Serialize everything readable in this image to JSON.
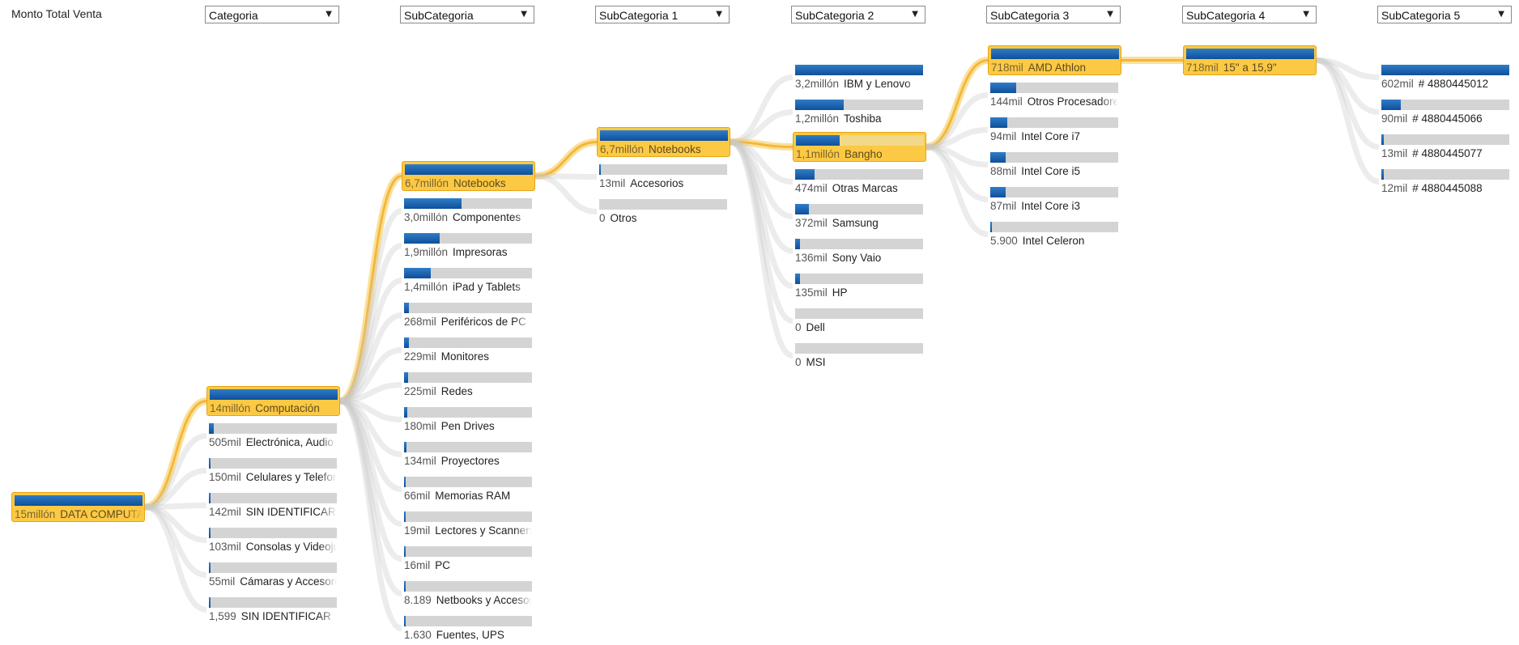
{
  "root_label": "Monto Total Venta",
  "dropdowns": [
    "Categoria",
    "SubCategoria",
    "SubCategoria 1",
    "SubCategoria 2",
    "SubCategoria 3",
    "SubCategoria 4",
    "SubCategoria 5"
  ],
  "colors": {
    "selected_bg": "#fcc944",
    "selected_border": "#e7a41a",
    "bar_fill": "#1a5fa8",
    "bar_track": "#d4d4d4",
    "connector": "#f7c64a"
  },
  "icons": {
    "dropdown_arrow": "chevron-down-icon"
  },
  "columns": [
    {
      "nodes": [
        {
          "value": "15millón",
          "label": "DATA COMPUTACION",
          "fill_pct": 100,
          "selected": true
        }
      ]
    },
    {
      "nodes": [
        {
          "value": "14millón",
          "label": "Computación",
          "fill_pct": 100,
          "selected": true
        },
        {
          "value": "505mil",
          "label": "Electrónica, Audio",
          "fill_pct": 4,
          "selected": false
        },
        {
          "value": "150mil",
          "label": "Celulares y Telefonía",
          "fill_pct": 1,
          "selected": false
        },
        {
          "value": "142mil",
          "label": "SIN IDENTIFICAR",
          "fill_pct": 1,
          "selected": false
        },
        {
          "value": "103mil",
          "label": "Consolas y Videojuegos",
          "fill_pct": 1,
          "selected": false
        },
        {
          "value": "55mil",
          "label": "Cámaras y Accesorios",
          "fill_pct": 0.5,
          "selected": false
        },
        {
          "value": "1,599",
          "label": "SIN IDENTIFICAR",
          "fill_pct": 0.2,
          "selected": false
        }
      ]
    },
    {
      "nodes": [
        {
          "value": "6,7millón",
          "label": "Notebooks",
          "fill_pct": 100,
          "selected": true
        },
        {
          "value": "3,0millón",
          "label": "Componentes",
          "fill_pct": 45,
          "selected": false
        },
        {
          "value": "1,9millón",
          "label": "Impresoras",
          "fill_pct": 28,
          "selected": false
        },
        {
          "value": "1,4millón",
          "label": "iPad y Tablets",
          "fill_pct": 21,
          "selected": false
        },
        {
          "value": "268mil",
          "label": "Periféricos de PC",
          "fill_pct": 4,
          "selected": false
        },
        {
          "value": "229mil",
          "label": "Monitores",
          "fill_pct": 3.5,
          "selected": false
        },
        {
          "value": "225mil",
          "label": "Redes",
          "fill_pct": 3.4,
          "selected": false
        },
        {
          "value": "180mil",
          "label": "Pen Drives",
          "fill_pct": 2.7,
          "selected": false
        },
        {
          "value": "134mil",
          "label": "Proyectores",
          "fill_pct": 2,
          "selected": false
        },
        {
          "value": "66mil",
          "label": "Memorias RAM",
          "fill_pct": 1,
          "selected": false
        },
        {
          "value": "19mil",
          "label": "Lectores y Scanners",
          "fill_pct": 0.4,
          "selected": false
        },
        {
          "value": "16mil",
          "label": "PC",
          "fill_pct": 0.3,
          "selected": false
        },
        {
          "value": "8.189",
          "label": "Netbooks y Accesorios",
          "fill_pct": 0.2,
          "selected": false
        },
        {
          "value": "1.630",
          "label": "Fuentes, UPS",
          "fill_pct": 0.1,
          "selected": false
        }
      ]
    },
    {
      "nodes": [
        {
          "value": "6,7millón",
          "label": "Notebooks",
          "fill_pct": 100,
          "selected": true
        },
        {
          "value": "13mil",
          "label": "Accesorios",
          "fill_pct": 0.3,
          "selected": false
        },
        {
          "value": "0",
          "label": "Otros",
          "fill_pct": 0,
          "selected": false
        }
      ]
    },
    {
      "nodes": [
        {
          "value": "3,2millón",
          "label": "IBM y Lenovo",
          "fill_pct": 100,
          "selected": false
        },
        {
          "value": "1,2millón",
          "label": "Toshiba",
          "fill_pct": 38,
          "selected": false
        },
        {
          "value": "1,1millón",
          "label": "Bangho",
          "fill_pct": 34,
          "selected": true
        },
        {
          "value": "474mil",
          "label": "Otras Marcas",
          "fill_pct": 15,
          "selected": false
        },
        {
          "value": "372mil",
          "label": "Samsung",
          "fill_pct": 11,
          "selected": false
        },
        {
          "value": "136mil",
          "label": "Sony Vaio",
          "fill_pct": 4,
          "selected": false
        },
        {
          "value": "135mil",
          "label": "HP",
          "fill_pct": 4,
          "selected": false
        },
        {
          "value": "0",
          "label": "Dell",
          "fill_pct": 0,
          "selected": false
        },
        {
          "value": "0",
          "label": "MSI",
          "fill_pct": 0,
          "selected": false
        }
      ]
    },
    {
      "nodes": [
        {
          "value": "718mil",
          "label": "AMD Athlon",
          "fill_pct": 100,
          "selected": true
        },
        {
          "value": "144mil",
          "label": "Otros Procesadores",
          "fill_pct": 20,
          "selected": false
        },
        {
          "value": "94mil",
          "label": "Intel Core i7",
          "fill_pct": 13,
          "selected": false
        },
        {
          "value": "88mil",
          "label": "Intel Core i5",
          "fill_pct": 12,
          "selected": false
        },
        {
          "value": "87mil",
          "label": "Intel Core i3",
          "fill_pct": 12,
          "selected": false
        },
        {
          "value": "5.900",
          "label": "Intel Celeron",
          "fill_pct": 1,
          "selected": false
        }
      ]
    },
    {
      "nodes": [
        {
          "value": "718mil",
          "label": "15\" a 15,9\"",
          "fill_pct": 100,
          "selected": true
        }
      ]
    },
    {
      "nodes": [
        {
          "value": "602mil",
          "label": "# 4880445012",
          "fill_pct": 100,
          "selected": false
        },
        {
          "value": "90mil",
          "label": "# 4880445066",
          "fill_pct": 15,
          "selected": false
        },
        {
          "value": "13mil",
          "label": "# 4880445077",
          "fill_pct": 2,
          "selected": false
        },
        {
          "value": "12mil",
          "label": "# 4880445088",
          "fill_pct": 2,
          "selected": false
        }
      ]
    }
  ]
}
